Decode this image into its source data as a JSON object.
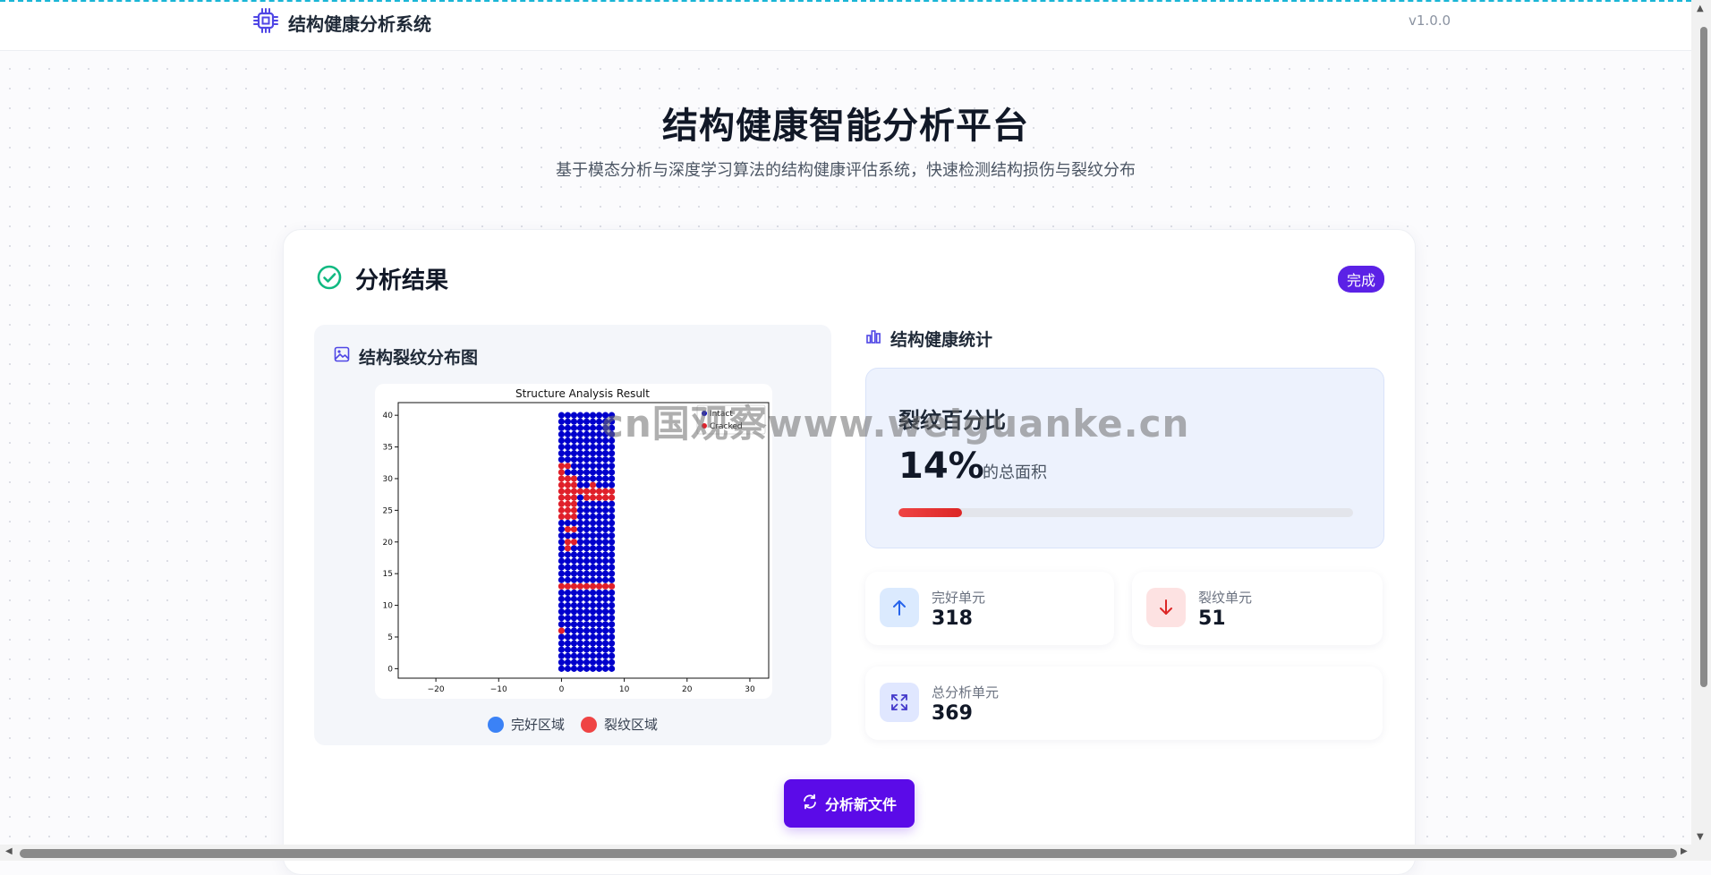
{
  "header": {
    "brand": "结构健康分析系统",
    "version": "v1.0.0",
    "logo_icon": "cpu-chip-icon"
  },
  "hero": {
    "title": "结构健康智能分析平台",
    "subtitle": "基于模态分析与深度学习算法的结构健康评估系统，快速检测结构损伤与裂纹分布"
  },
  "result": {
    "title": "分析结果",
    "status": "完成",
    "left_title": "结构裂纹分布图",
    "legend": {
      "intact": "完好区域",
      "cracked": "裂纹区域"
    },
    "right_title": "结构健康统计",
    "crack_ratio": {
      "label": "裂纹百分比",
      "value": "14%",
      "unit": "的总面积",
      "fraction": 0.14
    },
    "stats": [
      {
        "label": "完好单元",
        "value": "318",
        "icon": "arrow-up-icon"
      },
      {
        "label": "裂纹单元",
        "value": "51",
        "icon": "arrow-down-icon"
      },
      {
        "label": "总分析单元",
        "value": "369",
        "icon": "expand-icon"
      }
    ],
    "new_button": "分析新文件"
  },
  "chart_data": {
    "type": "scatter",
    "title": "Structure Analysis Result",
    "xlim": [
      -26,
      33
    ],
    "ylim": [
      -1.5,
      42
    ],
    "x_ticks": [
      -20,
      -10,
      0,
      10,
      20,
      30
    ],
    "y_ticks": [
      0,
      5,
      10,
      15,
      20,
      25,
      30,
      35,
      40
    ],
    "legend_labels": [
      "Intact",
      "Cracked"
    ],
    "legend_placement": "top-right",
    "grid": "9 columns (x = 0..8) by 41 rows (y = 0..40), 369 points",
    "series": [
      {
        "name": "Intact",
        "color": "#0000cc",
        "count": 318
      },
      {
        "name": "Cracked",
        "color": "#e0202a",
        "count": 51,
        "points": [
          [
            0,
            6
          ],
          [
            0,
            13
          ],
          [
            1,
            13
          ],
          [
            2,
            13
          ],
          [
            3,
            13
          ],
          [
            4,
            13
          ],
          [
            5,
            13
          ],
          [
            6,
            13
          ],
          [
            7,
            13
          ],
          [
            8,
            13
          ],
          [
            1,
            19
          ],
          [
            1,
            20
          ],
          [
            2,
            20
          ],
          [
            1,
            22
          ],
          [
            2,
            22
          ],
          [
            0,
            24
          ],
          [
            1,
            24
          ],
          [
            2,
            24
          ],
          [
            0,
            25
          ],
          [
            1,
            25
          ],
          [
            2,
            25
          ],
          [
            0,
            26
          ],
          [
            1,
            26
          ],
          [
            2,
            26
          ],
          [
            0,
            27
          ],
          [
            1,
            27
          ],
          [
            2,
            27
          ],
          [
            4,
            27
          ],
          [
            5,
            27
          ],
          [
            6,
            27
          ],
          [
            7,
            27
          ],
          [
            8,
            27
          ],
          [
            0,
            28
          ],
          [
            1,
            28
          ],
          [
            2,
            28
          ],
          [
            3,
            28
          ],
          [
            4,
            28
          ],
          [
            5,
            28
          ],
          [
            6,
            28
          ],
          [
            7,
            28
          ],
          [
            8,
            28
          ],
          [
            0,
            29
          ],
          [
            1,
            29
          ],
          [
            2,
            29
          ],
          [
            5,
            29
          ],
          [
            0,
            30
          ],
          [
            1,
            30
          ],
          [
            2,
            30
          ],
          [
            0,
            31
          ],
          [
            0,
            32
          ],
          [
            1,
            32
          ]
        ]
      }
    ]
  },
  "colors": {
    "accent": "#5b0be8",
    "intact": "#3b82f6",
    "cracked": "#ef4444",
    "success": "#10b981"
  },
  "watermark": "cn国观察www.weiguanke.cn"
}
